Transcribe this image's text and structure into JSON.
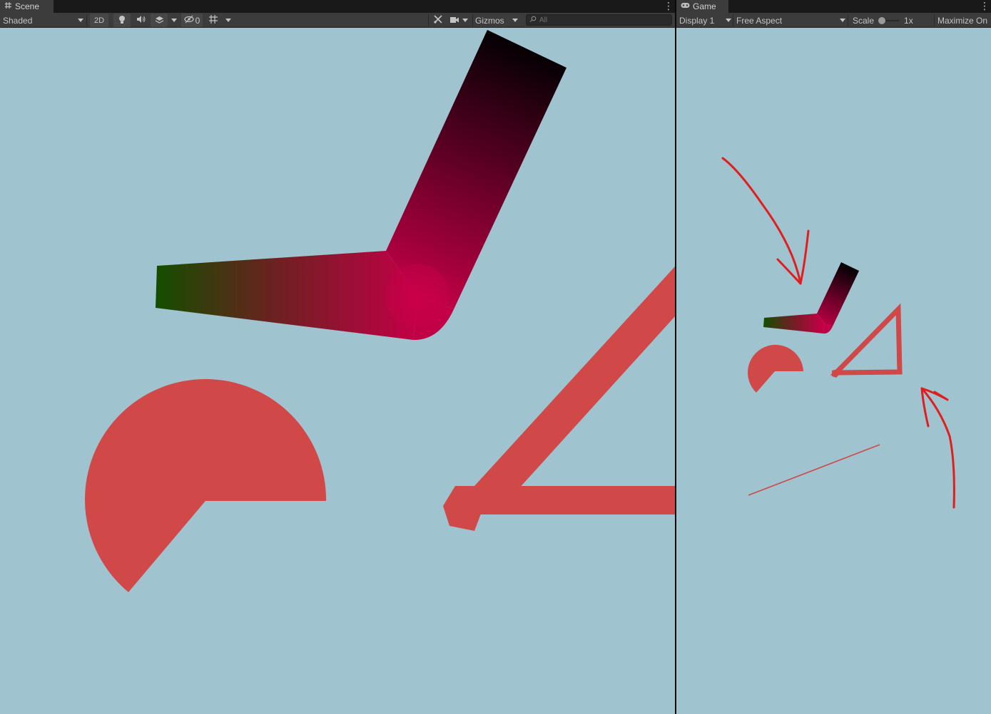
{
  "scene": {
    "tab_label": "Scene",
    "tab_icon": "hash-icon",
    "draw_mode": "Shaded",
    "mode_2d_label": "2D",
    "hidden_count": "0",
    "gizmos_label": "Gizmos",
    "search_placeholder": "All"
  },
  "game": {
    "tab_label": "Game",
    "tab_icon": "gamepad-icon",
    "display_label": "Display 1",
    "aspect_label": "Free Aspect",
    "scale_label": "Scale",
    "scale_value": "1x",
    "maximize_label": "Maximize On"
  },
  "colors": {
    "viewport_bg": "#9fc3cf",
    "shape_red": "#d14848",
    "annotation_red": "#e01e1e",
    "gradient_green": "#154d00",
    "gradient_magenta": "#c20046",
    "gradient_black": "#050004"
  }
}
